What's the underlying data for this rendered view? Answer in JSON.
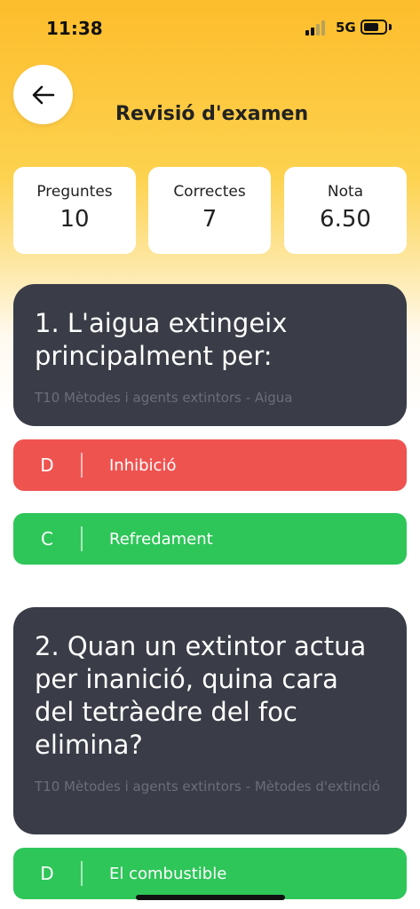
{
  "status_bar": {
    "time": "11:38",
    "network": "5G"
  },
  "header": {
    "title": "Revisió d'examen"
  },
  "stats": [
    {
      "label": "Preguntes",
      "value": "10"
    },
    {
      "label": "Correctes",
      "value": "7"
    },
    {
      "label": "Nota",
      "value": "6.50"
    }
  ],
  "questions": [
    {
      "text": "1. L'aigua extingeix principalment per:",
      "topic": "T10 Mètodes i agents extintors - Aigua",
      "answers": [
        {
          "letter": "D",
          "text": "Inhibició",
          "status": "wrong"
        },
        {
          "letter": "C",
          "text": "Refredament",
          "status": "correct"
        }
      ]
    },
    {
      "text": "2. Quan un extintor actua per inanició, quina cara del tetràedre del foc elimina?",
      "topic": "T10 Mètodes i agents extintors - Mètodes d'extinció",
      "answers": [
        {
          "letter": "D",
          "text": "El combustible",
          "status": "correct"
        }
      ]
    }
  ],
  "colors": {
    "wrong": "#ef5350",
    "correct": "#2ec659",
    "card": "#3a3d47",
    "accent": "#fdbd2c"
  }
}
